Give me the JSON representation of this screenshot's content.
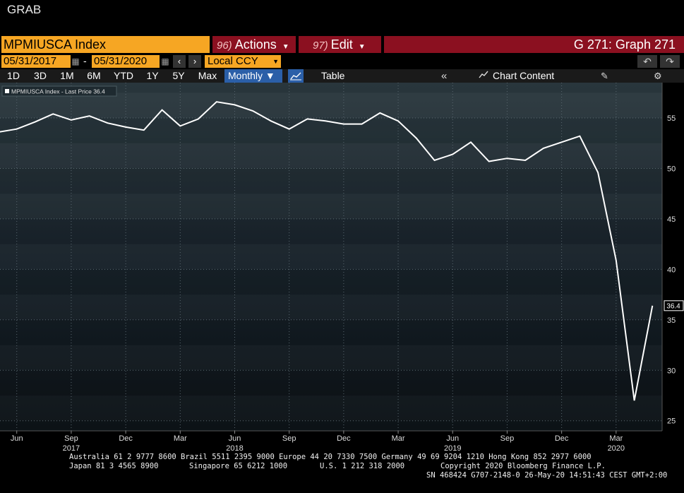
{
  "top_label": "GRAB",
  "toolbar": {
    "ticker": "MPMIUSCA Index",
    "actions_num": "96)",
    "actions_label": "Actions",
    "edit_num": "97)",
    "edit_label": "Edit",
    "graph_title": "G 271: Graph 271",
    "start_date": "05/31/2017",
    "end_date": "05/31/2020",
    "separator": "-",
    "currency": "Local CCY",
    "timeframes": [
      "1D",
      "3D",
      "1M",
      "6M",
      "YTD",
      "1Y",
      "5Y",
      "Max"
    ],
    "periodicity": "Monthly",
    "table_label": "Table",
    "chart_content_label": "Chart Content"
  },
  "icons": {
    "calendar": "calendar-icon",
    "prev": "arrow-left-icon",
    "next": "arrow-right-icon",
    "dropdown": "chevron-down-icon",
    "undo": "undo-icon",
    "redo": "redo-icon",
    "chart_type": "line-chart-icon",
    "collapse": "double-chevron-left-icon",
    "chart_content": "chart-content-icon",
    "edit": "pencil-icon",
    "settings": "gear-icon"
  },
  "colors": {
    "accent_orange": "#f6a623",
    "menu_red": "#8b1020",
    "active_blue": "#2b5fa8",
    "line": "#ffffff"
  },
  "chart_data": {
    "type": "line",
    "legend_label": "MPMIUSCA Index - Last Price 36.4",
    "last_value_label": "36.4",
    "x": [
      "2017-05",
      "2017-06",
      "2017-07",
      "2017-08",
      "2017-09",
      "2017-10",
      "2017-11",
      "2017-12",
      "2018-01",
      "2018-02",
      "2018-03",
      "2018-04",
      "2018-05",
      "2018-06",
      "2018-07",
      "2018-08",
      "2018-09",
      "2018-10",
      "2018-11",
      "2018-12",
      "2019-01",
      "2019-02",
      "2019-03",
      "2019-04",
      "2019-05",
      "2019-06",
      "2019-07",
      "2019-08",
      "2019-09",
      "2019-10",
      "2019-11",
      "2019-12",
      "2020-01",
      "2020-02",
      "2020-03",
      "2020-04",
      "2020-05"
    ],
    "series": [
      {
        "values": [
          53.6,
          53.9,
          54.6,
          55.4,
          54.8,
          55.2,
          54.5,
          54.1,
          53.8,
          55.8,
          54.2,
          54.9,
          56.6,
          56.3,
          55.7,
          54.7,
          53.9,
          54.9,
          54.7,
          54.4,
          54.4,
          55.5,
          54.7,
          53.0,
          50.8,
          51.4,
          52.6,
          50.7,
          51.0,
          50.8,
          52.0,
          52.6,
          53.2,
          49.6,
          40.9,
          27.0,
          36.4
        ]
      }
    ],
    "ylim": [
      24,
      58.5
    ],
    "yticks": [
      25,
      30,
      35,
      40,
      45,
      50,
      55
    ],
    "month_ticks": [
      {
        "label": "Jun",
        "x": "2017-06"
      },
      {
        "label": "Sep",
        "x": "2017-09"
      },
      {
        "label": "Dec",
        "x": "2017-12"
      },
      {
        "label": "Mar",
        "x": "2018-03"
      },
      {
        "label": "Jun",
        "x": "2018-06"
      },
      {
        "label": "Sep",
        "x": "2018-09"
      },
      {
        "label": "Dec",
        "x": "2018-12"
      },
      {
        "label": "Mar",
        "x": "2019-03"
      },
      {
        "label": "Jun",
        "x": "2019-06"
      },
      {
        "label": "Sep",
        "x": "2019-09"
      },
      {
        "label": "Dec",
        "x": "2019-12"
      },
      {
        "label": "Mar",
        "x": "2020-03"
      }
    ],
    "year_ticks": [
      {
        "label": "2017",
        "x": "2017-09"
      },
      {
        "label": "2018",
        "x": "2018-06"
      },
      {
        "label": "2019",
        "x": "2019-06"
      },
      {
        "label": "2020",
        "x": "2020-03"
      }
    ],
    "grid": true
  },
  "footer": {
    "line1": "Australia 61 2 9777 8600 Brazil 5511 2395 9000 Europe 44 20 7330 7500 Germany 49 69 9204 1210 Hong Kong 852 2977 6000",
    "line2a": "Japan 81 3 4565 8900",
    "line2b": "Singapore 65 6212 1000",
    "line2c": "U.S. 1 212 318 2000",
    "line2d": "Copyright 2020 Bloomberg Finance L.P.",
    "line3": "SN 468424 G707-2148-0 26-May-20 14:51:43 CEST GMT+2:00"
  }
}
